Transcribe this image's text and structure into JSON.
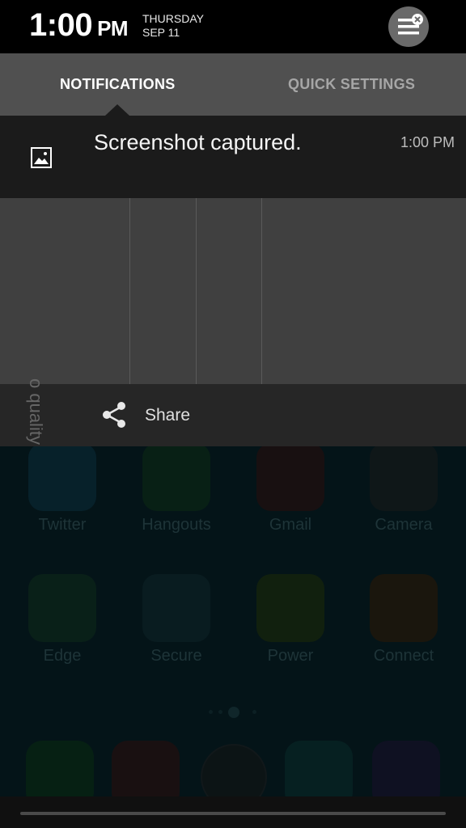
{
  "status_bar": {
    "time": "1:00",
    "ampm": "PM",
    "day": "THURSDAY",
    "date": "SEP 11"
  },
  "tabs": [
    {
      "label": "NOTIFICATIONS",
      "active": true
    },
    {
      "label": "QUICK SETTINGS",
      "active": false
    }
  ],
  "notification": {
    "title": "Screenshot captured.",
    "time": "1:00 PM",
    "icon": "image-icon"
  },
  "preview": {
    "partial_text": "o quality"
  },
  "share_action": {
    "label": "Share",
    "icon": "share-icon"
  },
  "home_apps": [
    {
      "label": "Twitter"
    },
    {
      "label": "Hangouts"
    },
    {
      "label": "Gmail"
    },
    {
      "label": "Camera"
    },
    {
      "label": "Edge"
    },
    {
      "label": "Secure"
    },
    {
      "label": "Power"
    },
    {
      "label": "Connect"
    }
  ],
  "colors": {
    "panel": "#1b1b1b",
    "tabs_bg": "#505050",
    "preview_bg": "#404040",
    "share_bg": "#262626"
  }
}
